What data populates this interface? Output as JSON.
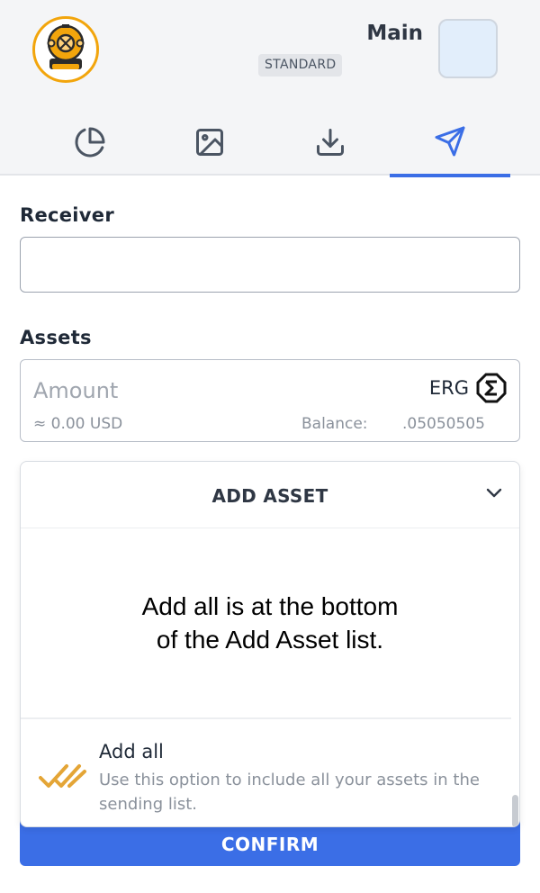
{
  "header": {
    "wallet_name": "Main",
    "wallet_type": "STANDARD"
  },
  "tabs": [
    {
      "icon": "pie-chart-icon",
      "active": false
    },
    {
      "icon": "image-icon",
      "active": false
    },
    {
      "icon": "download-icon",
      "active": false
    },
    {
      "icon": "send-icon",
      "active": true
    }
  ],
  "form": {
    "receiver_label": "Receiver",
    "receiver_value": "",
    "receiver_placeholder": "",
    "assets_label": "Assets",
    "amount_placeholder": "Amount",
    "token_name": "ERG",
    "token_icon": "erg-sigma-icon",
    "usd_value": "≈ 0.00 USD",
    "balance_label": "Balance:",
    "balance_value": ".05050505"
  },
  "dropdown": {
    "title": "ADD ASSET",
    "annotation_line1": "Add all is at the bottom",
    "annotation_line2": "of the Add Asset list.",
    "add_all_title": "Add all",
    "add_all_description": "Use this option to include all your assets in the sending list."
  },
  "confirm_label": "CONFIRM",
  "colors": {
    "accent": "#3b6ee6",
    "logo_orange": "#f2a50c",
    "header_bg": "#f4f5f7",
    "avatar_bg": "#e2eefb"
  }
}
